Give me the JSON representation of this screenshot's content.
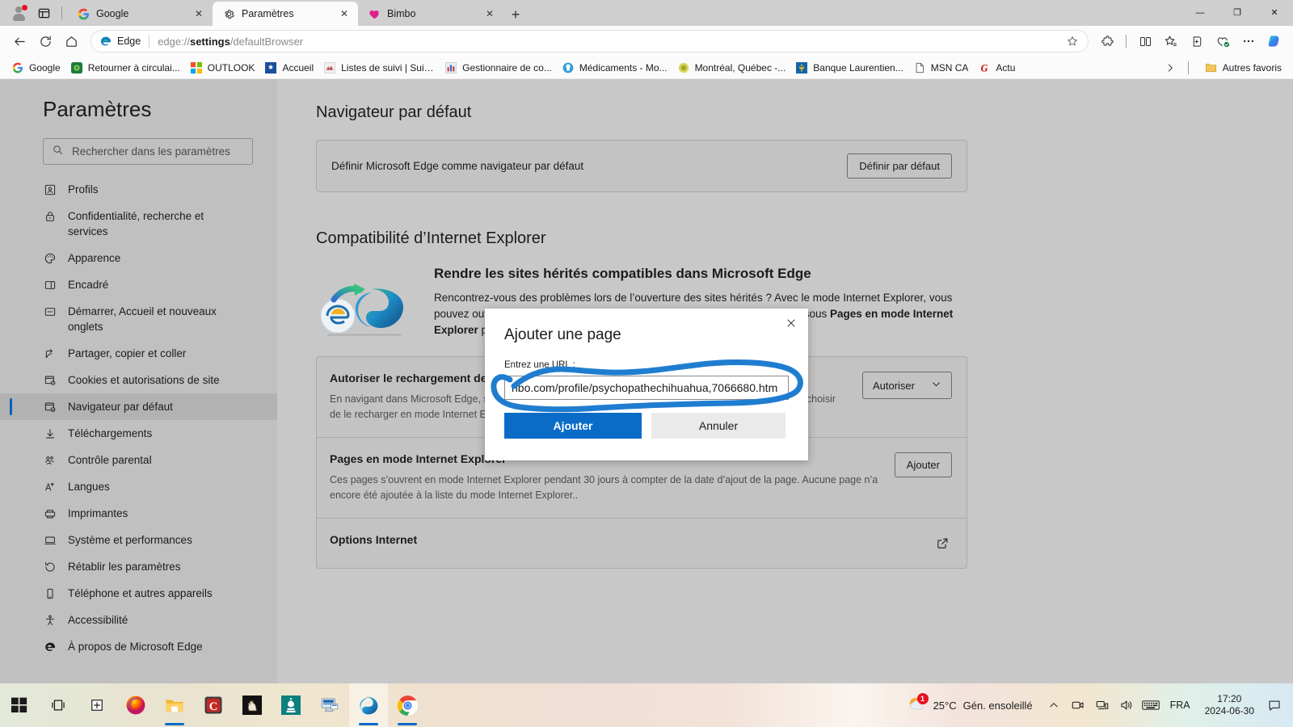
{
  "window": {
    "controls": {
      "minimize": "—",
      "maximize": "❐",
      "close": "✕"
    }
  },
  "tabstrip": {
    "profile_icon": "profile-avatar-icon",
    "tab_search_icon": "tab-actions-icon",
    "new_tab_label": "+",
    "tabs": [
      {
        "title": "Google",
        "favicon": "google-favicon",
        "active": false,
        "close": "✕"
      },
      {
        "title": "Paramètres",
        "favicon": "settings-gear-favicon",
        "active": true,
        "close": "✕"
      },
      {
        "title": "Bimbo",
        "favicon": "heart-favicon",
        "active": false,
        "close": "✕"
      }
    ]
  },
  "navbar": {
    "back_icon": "back-arrow-icon",
    "reload_icon": "reload-icon",
    "home_icon": "home-icon",
    "brand_label": "Edge",
    "url_prefix": "edge://",
    "url_bold": "settings",
    "url_suffix": "/defaultBrowser",
    "favorite_icon": "star-outline-icon",
    "right_icons": [
      "extensions-icon",
      "split-screen-icon",
      "favorites-icon",
      "collections-icon",
      "browser-essentials-icon",
      "settings-more-icon",
      "copilot-icon"
    ]
  },
  "bookmarks": {
    "items": [
      {
        "label": "Google",
        "icon": "google-favicon"
      },
      {
        "label": "Retourner à circulai...",
        "icon": "circular-favicon"
      },
      {
        "label": "OUTLOOK",
        "icon": "microsoft-favicon"
      },
      {
        "label": "Accueil",
        "icon": "quebec-favicon"
      },
      {
        "label": "Listes de suivi | Suiv...",
        "icon": "watchlist-favicon"
      },
      {
        "label": "Gestionnaire de co...",
        "icon": "manager-favicon"
      },
      {
        "label": "Médicaments - Mo...",
        "icon": "medication-favicon"
      },
      {
        "label": "Montréal, Québec -...",
        "icon": "weather-favicon"
      },
      {
        "label": "Banque Laurentien...",
        "icon": "bank-favicon"
      },
      {
        "label": "MSN CA",
        "icon": "page-favicon"
      },
      {
        "label": "Actu",
        "icon": "actu-favicon"
      }
    ],
    "overflow_icon": "chevron-right-icon",
    "other_favorites_label": "Autres favoris",
    "other_favorites_icon": "folder-icon"
  },
  "sidebar": {
    "title": "Paramètres",
    "search": {
      "placeholder": "Rechercher dans les paramètres",
      "icon": "search-icon"
    },
    "items": [
      {
        "label": "Profils",
        "icon": "profile-icon",
        "selected": false
      },
      {
        "label": "Confidentialité, recherche et services",
        "icon": "lock-icon",
        "selected": false
      },
      {
        "label": "Apparence",
        "icon": "palette-icon",
        "selected": false
      },
      {
        "label": "Encadré",
        "icon": "sidebar-panel-icon",
        "selected": false
      },
      {
        "label": "Démarrer, Accueil et nouveaux onglets",
        "icon": "new-tab-page-icon",
        "selected": false
      },
      {
        "label": "Partager, copier et coller",
        "icon": "share-icon",
        "selected": false
      },
      {
        "label": "Cookies et autorisations de site",
        "icon": "cookies-icon",
        "selected": false
      },
      {
        "label": "Navigateur par défaut",
        "icon": "default-browser-icon",
        "selected": true
      },
      {
        "label": "Téléchargements",
        "icon": "download-icon",
        "selected": false
      },
      {
        "label": "Contrôle parental",
        "icon": "family-icon",
        "selected": false
      },
      {
        "label": "Langues",
        "icon": "language-icon",
        "selected": false
      },
      {
        "label": "Imprimantes",
        "icon": "printer-icon",
        "selected": false
      },
      {
        "label": "Système et performances",
        "icon": "system-icon",
        "selected": false
      },
      {
        "label": "Rétablir les paramètres",
        "icon": "reset-icon",
        "selected": false
      },
      {
        "label": "Téléphone et autres appareils",
        "icon": "phone-icon",
        "selected": false
      },
      {
        "label": "Accessibilité",
        "icon": "accessibility-icon",
        "selected": false
      },
      {
        "label": "À propos de Microsoft Edge",
        "icon": "edge-logo-icon",
        "selected": false
      }
    ]
  },
  "main": {
    "heading_default_browser": "Navigateur par défaut",
    "default_browser_row": {
      "text": "Définir Microsoft Edge comme navigateur par défaut",
      "button": "Définir par défaut"
    },
    "heading_ie_compat": "Compatibilité d’Internet Explorer",
    "ie_block": {
      "title": "Rendre les sites hérités compatibles dans Microsoft Edge",
      "description_part1": "Rencontrez-vous des problèmes lors de l’ouverture des sites hérités ? Avec le mode Internet Explorer, vous pouvez ouvrir des sites hérités dans Microsoft Edge. Ajoutez des sites ci-dessous ",
      "description_bold1": "Pages en mode Internet Explorer",
      "description_part2": " pour qu’ils s’ouvrent automatiquement en mode Internet Explorer.",
      "art_icon": "ie-to-edge-migration-art"
    },
    "sections": [
      {
        "title": "Autoriser le rechargement des sites en mode Internet Explorer",
        "desc": "En navigant dans Microsoft Edge, si un site nécessite Internet Explorer pour être compatible, vous pouvez choisir de le recharger en mode Internet Explorer",
        "control": "Autoriser",
        "control_type": "select",
        "chevron": "chevron-down-icon"
      },
      {
        "title": "Pages en mode Internet Explorer",
        "desc": "Ces pages s’ouvrent en mode Internet Explorer pendant 30 jours à compter de la date d’ajout de la page. Aucune page n’a encore été ajoutée à la liste du mode Internet Explorer..",
        "control": "Ajouter",
        "control_type": "button"
      },
      {
        "title": "Options Internet",
        "desc": "",
        "control": "",
        "control_type": "external-link",
        "icon": "external-link-icon"
      }
    ]
  },
  "dialog": {
    "title": "Ajouter une page",
    "close_icon": "close-icon",
    "field_label": "Entrez une URL :",
    "input_value": "nbo.com/profile/psychopathechihuahua,7066680.htm",
    "input_placeholder": "",
    "primary_button": "Ajouter",
    "secondary_button": "Annuler",
    "annotation": {
      "shape": "hand-drawn-ellipse",
      "color": "#1f7dd0"
    }
  },
  "taskbar": {
    "icons": [
      {
        "name": "start-windows-icon",
        "running": false
      },
      {
        "name": "task-view-icon",
        "running": false
      },
      {
        "name": "new-desktop-icon",
        "running": false
      },
      {
        "name": "firefox-icon",
        "running": false
      },
      {
        "name": "file-explorer-icon",
        "running": true
      },
      {
        "name": "camtasia-icon",
        "running": false
      },
      {
        "name": "chess-knight-icon",
        "running": false
      },
      {
        "name": "chess-king-icon",
        "running": false
      },
      {
        "name": "remote-desktop-icon",
        "running": false
      },
      {
        "name": "microsoft-edge-icon",
        "running": true
      },
      {
        "name": "google-chrome-icon",
        "running": true
      }
    ],
    "weather": {
      "temperature": "25°C",
      "condition": "Gén. ensoleillé",
      "badge_count": "1",
      "icon": "sun-cloud-icon"
    },
    "tray_icons": [
      "show-hidden-icons-chevron",
      "meet-now-icon",
      "network-icon",
      "volume-icon",
      "keyboard-icon"
    ],
    "language": "FRA",
    "clock": {
      "time": "17:20",
      "date": "2024-06-30"
    },
    "notification_icon": "notification-icon"
  },
  "colors": {
    "accent_blue": "#0a6cc7",
    "annotation_blue": "#1f7dd0",
    "selected_sidebar": "#b2b2b2",
    "page_bg": "#c8c8c8",
    "badge_red": "#e81123"
  }
}
